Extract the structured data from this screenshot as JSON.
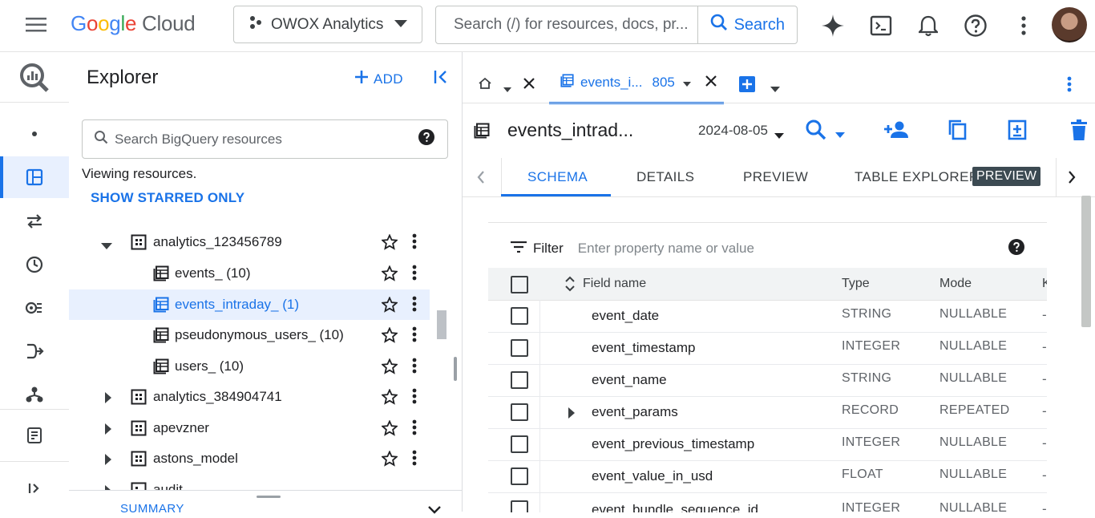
{
  "topbar": {
    "logo_text": "Google Cloud",
    "project": "OWOX Analytics",
    "search_placeholder": "Search (/) for resources, docs, pr...",
    "search_button": "Search",
    "icons": [
      "menu-icon",
      "gemini-sparkle-icon",
      "cloud-shell-icon",
      "notifications-icon",
      "help-icon",
      "more-vert-icon",
      "avatar"
    ]
  },
  "rail": {
    "icons": [
      "bigquery-logo-icon",
      "dot-icon",
      "studio-icon",
      "data-transfers-icon",
      "scheduled-queries-icon",
      "analytics-hub-icon",
      "dataform-icon",
      "pipelines-icon",
      "release-notes-icon",
      "expand-icon"
    ]
  },
  "explorer": {
    "title": "Explorer",
    "add_label": "ADD",
    "search_placeholder": "Search BigQuery resources",
    "viewing": "Viewing resources.",
    "show_starred": "SHOW STARRED ONLY",
    "tree": [
      {
        "label": "analytics_123456789",
        "level": 0,
        "expanded": true
      },
      {
        "label": "events_ (10)",
        "level": 1
      },
      {
        "label": "events_intraday_ (1)",
        "level": 1,
        "selected": true
      },
      {
        "label": "pseudonymous_users_ (10)",
        "level": 1
      },
      {
        "label": "users_ (10)",
        "level": 1
      },
      {
        "label": "analytics_384904741",
        "level": 0,
        "expanded": false
      },
      {
        "label": "apevzner",
        "level": 0,
        "expanded": false
      },
      {
        "label": "astons_model",
        "level": 0,
        "expanded": false
      },
      {
        "label": "audit",
        "level": 0,
        "expanded": false
      }
    ],
    "summary_label": "SUMMARY"
  },
  "tabs": {
    "active_tab_name": "events_i...",
    "active_tab_suffix": "805"
  },
  "table": {
    "name": "events_intrad...",
    "date": "2024-08-05",
    "subtabs": [
      "SCHEMA",
      "DETAILS",
      "PREVIEW",
      "TABLE EXPLORER"
    ],
    "preview_badge": "PREVIEW",
    "active_subtab": "SCHEMA"
  },
  "schema": {
    "filter_label": "Filter",
    "filter_placeholder": "Enter property name or value",
    "headers": {
      "field": "Field name",
      "type": "Type",
      "mode": "Mode",
      "key": "K"
    },
    "rows": [
      {
        "field": "event_date",
        "type": "STRING",
        "mode": "NULLABLE",
        "key": "-"
      },
      {
        "field": "event_timestamp",
        "type": "INTEGER",
        "mode": "NULLABLE",
        "key": "-"
      },
      {
        "field": "event_name",
        "type": "STRING",
        "mode": "NULLABLE",
        "key": "-"
      },
      {
        "field": "event_params",
        "type": "RECORD",
        "mode": "REPEATED",
        "key": "-",
        "expandable": true
      },
      {
        "field": "event_previous_timestamp",
        "type": "INTEGER",
        "mode": "NULLABLE",
        "key": "-"
      },
      {
        "field": "event_value_in_usd",
        "type": "FLOAT",
        "mode": "NULLABLE",
        "key": "-"
      },
      {
        "field": "event_bundle_sequence_id",
        "type": "INTEGER",
        "mode": "NULLABLE",
        "key": "-"
      }
    ]
  },
  "colors": {
    "accent": "#1a73e8",
    "selected_bg": "#e8f0fe",
    "badge_bg": "#3c4a52"
  }
}
